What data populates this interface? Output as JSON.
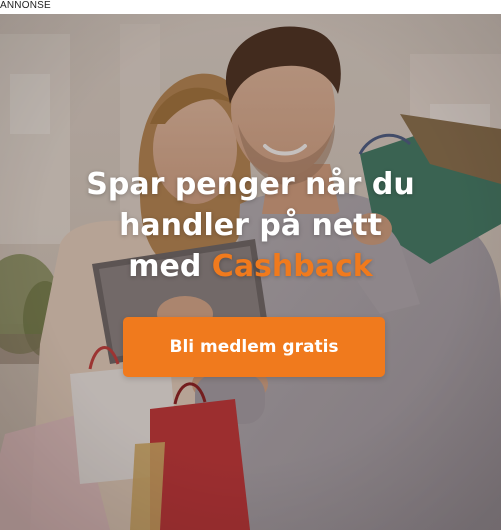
{
  "ad": {
    "label": "ANNONSE",
    "headline": {
      "line1": "Spar penger når du",
      "line2": "handler på nett",
      "line3_prefix": "med ",
      "line3_accent": "Cashback"
    },
    "cta_label": "Bli medlem gratis"
  },
  "colors": {
    "accent": "#f07a1d",
    "headline_text": "#ffffff",
    "overlay": "rgba(45,30,20,0.28)"
  }
}
